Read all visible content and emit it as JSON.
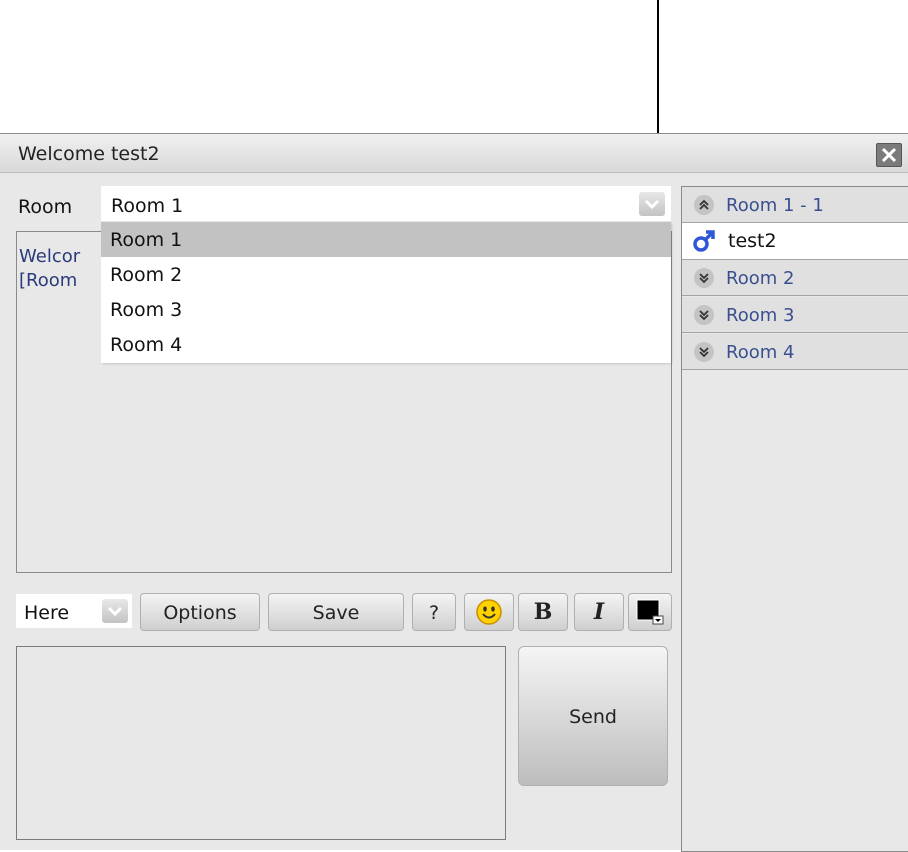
{
  "window": {
    "title": "Welcome test2"
  },
  "room_selector": {
    "label": "Room",
    "value": "Room 1",
    "options": [
      "Room 1",
      "Room 2",
      "Room 3",
      "Room 4"
    ],
    "highlighted_index": 0
  },
  "chat_log": {
    "lines": [
      "Welcor",
      "[Room"
    ]
  },
  "toolbar": {
    "target_value": "Here",
    "options_label": "Options",
    "save_label": "Save",
    "help_label": "?",
    "bold_label": "B",
    "italic_label": "I"
  },
  "send": {
    "label": "Send"
  },
  "rooms_panel": {
    "rooms": [
      {
        "label": "Room 1 - 1",
        "expanded": true,
        "users": [
          "test2"
        ]
      },
      {
        "label": "Room 2",
        "expanded": false
      },
      {
        "label": "Room 3",
        "expanded": false
      },
      {
        "label": "Room 4",
        "expanded": false
      }
    ]
  },
  "colors": {
    "room_label": "#3a4f8f",
    "log_text": "#2b3a7a",
    "male_icon": "#2f57d6"
  },
  "icons": [
    "close-icon",
    "chevron-down-icon",
    "smiley-icon",
    "color-picker-icon",
    "chevron-up-double-icon",
    "chevron-down-double-icon",
    "male-icon"
  ]
}
